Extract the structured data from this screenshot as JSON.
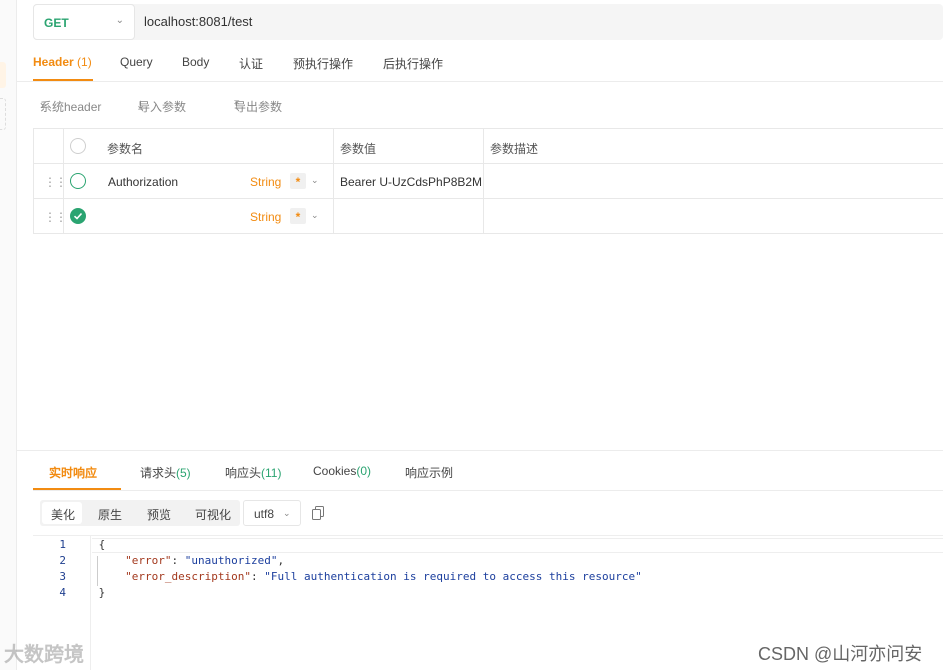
{
  "request": {
    "method": "GET",
    "url": "localhost:8081/test"
  },
  "request_tabs": [
    {
      "label": "Header",
      "count": "(1)",
      "active": true
    },
    {
      "label": "Query"
    },
    {
      "label": "Body"
    },
    {
      "label": "认证"
    },
    {
      "label": "预执行操作"
    },
    {
      "label": "后执行操作"
    }
  ],
  "header_tools": {
    "system_header": "系统header",
    "import": "导入参数",
    "export": "导出参数"
  },
  "params_table": {
    "columns": [
      "参数名",
      "参数值",
      "参数描述"
    ],
    "rows": [
      {
        "name": "Authorization",
        "type": "String",
        "required": "*",
        "value": "Bearer U-UzCdsPhP8B2M",
        "description": "",
        "checked": false
      },
      {
        "name": "",
        "type": "String",
        "required": "*",
        "value": "",
        "description": "",
        "checked": true
      }
    ]
  },
  "response_tabs": [
    {
      "label": "实时响应",
      "active": true
    },
    {
      "label": "请求头",
      "count": "(5)"
    },
    {
      "label": "响应头",
      "count": "(11)"
    },
    {
      "label": "Cookies",
      "count": "(0)"
    },
    {
      "label": "响应示例"
    }
  ],
  "view_modes": [
    "美化",
    "原生",
    "预览",
    "可视化"
  ],
  "encoding": "utf8",
  "code": {
    "line_numbers": [
      "1",
      "2",
      "3",
      "4"
    ],
    "open_brace": "{",
    "close_brace": "}",
    "line2_key": "\"error\"",
    "line2_value": "\"unauthorized\"",
    "line3_key": "\"error_description\"",
    "line3_value": "\"Full authentication is required to access this resource\""
  },
  "watermarks": {
    "left": "大数跨境",
    "right": "CSDN @山河亦问安"
  },
  "colors": {
    "accent": "#f28b11",
    "success": "#2ba471"
  },
  "icons": [
    "chevron-down-icon",
    "chevron-right-icon",
    "import-icon",
    "export-icon",
    "drag-handle-icon",
    "check-circle-icon",
    "copy-icon"
  ]
}
